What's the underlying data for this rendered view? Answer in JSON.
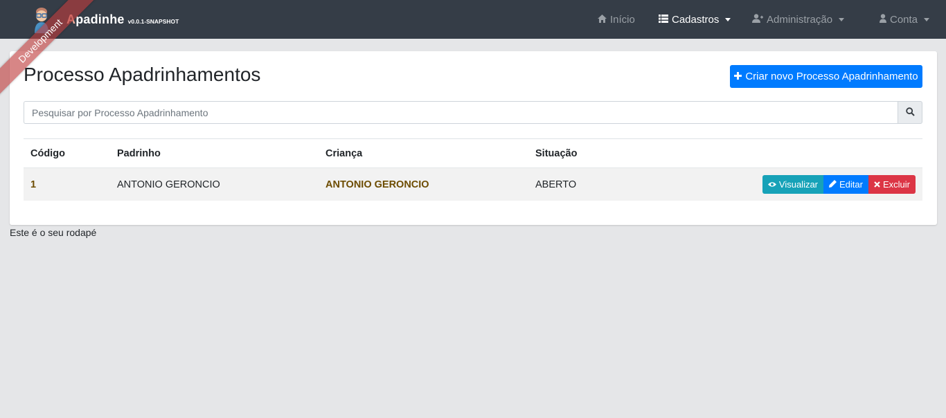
{
  "navbar": {
    "brand_first_letter": "A",
    "brand_rest": "padinhe",
    "version": "v0.0.1-SNAPSHOT",
    "ribbon": "Development",
    "items": [
      {
        "label": "Início",
        "icon": "home-icon"
      },
      {
        "label": "Cadastros",
        "icon": "list-icon"
      },
      {
        "label": "Administração",
        "icon": "user-plus-icon"
      },
      {
        "label": "Conta",
        "icon": "user-icon"
      }
    ],
    "colors": {
      "background": "#353d47",
      "active": "#ffffff",
      "inactive": "#9aa0a6"
    }
  },
  "page": {
    "title": "Processo Apadrinhamentos",
    "create_button": "Criar novo Processo Apadrinhamento",
    "search_placeholder": "Pesquisar por Processo Apadrinhamento"
  },
  "table": {
    "headers": [
      "Código",
      "Padrinho",
      "Criança",
      "Situação"
    ],
    "rows": [
      {
        "codigo": "1",
        "padrinho": "ANTONIO GERONCIO",
        "crianca": "ANTONIO GERONCIO",
        "situacao": "ABERTO"
      }
    ],
    "actions": {
      "view": "Visualizar",
      "edit": "Editar",
      "delete": "Excluir"
    }
  },
  "footer": {
    "text": "Este é o seu rodapé"
  },
  "colors": {
    "primary": "#007bff",
    "info": "#17a2b8",
    "danger": "#dc3545",
    "link": "#6d4c00",
    "page_background": "#e5e6e8"
  }
}
